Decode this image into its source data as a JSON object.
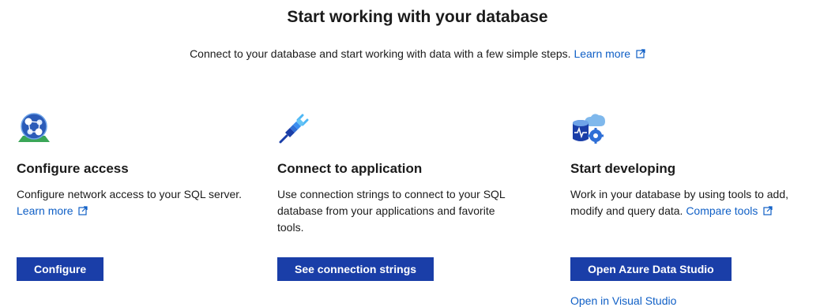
{
  "header": {
    "title": "Start working with your database",
    "subtitle": "Connect to your database and start working with data with a few simple steps.",
    "learn_more": "Learn more"
  },
  "cards": [
    {
      "title": "Configure access",
      "desc": "Configure network access to your SQL server.",
      "link": "Learn more",
      "button": "Configure",
      "icon": "globe-network-icon"
    },
    {
      "title": "Connect to application",
      "desc": "Use connection strings to connect to your SQL database from your applications and favorite tools.",
      "button": "See connection strings",
      "icon": "plug-connector-icon"
    },
    {
      "title": "Start developing",
      "desc": "Work in your database by using tools to add, modify and query data.",
      "link": "Compare tools",
      "button": "Open Azure Data Studio",
      "secondary_link": "Open in Visual Studio",
      "icon": "database-cloud-gear-icon"
    }
  ],
  "colors": {
    "accent": "#1a3ea8",
    "link": "#0f5fc6"
  }
}
